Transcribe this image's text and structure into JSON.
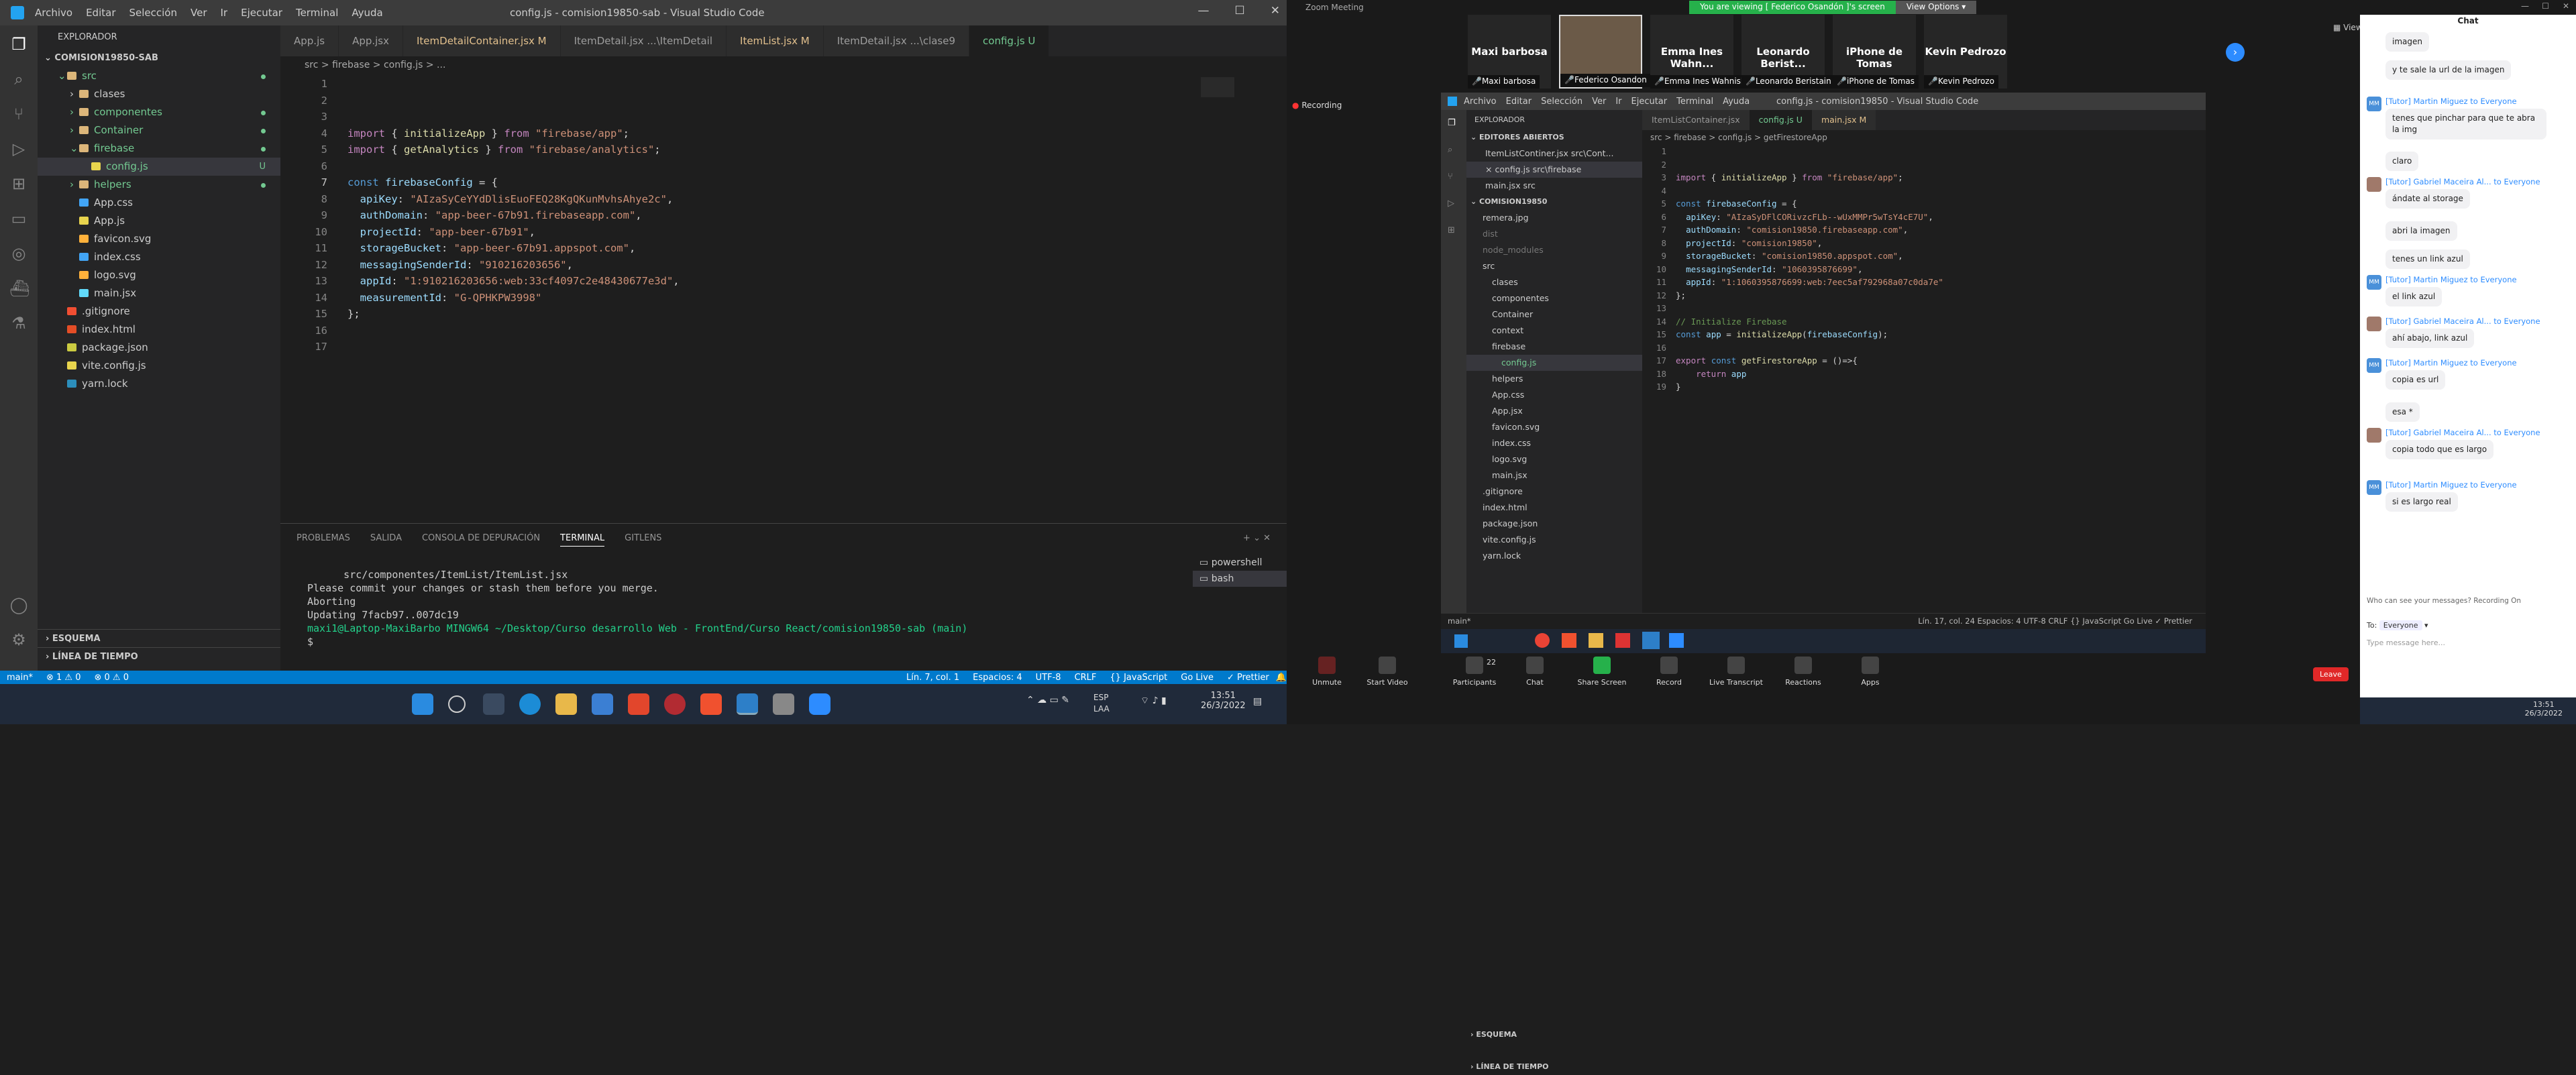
{
  "left_vscode": {
    "title": "config.js - comision19850-sab - Visual Studio Code",
    "menu": [
      "Archivo",
      "Editar",
      "Selección",
      "Ver",
      "Ir",
      "Ejecutar",
      "Terminal",
      "Ayuda"
    ],
    "explorer_title": "EXPLORADOR",
    "project": "COMISION19850-SAB",
    "tree": [
      {
        "label": "src",
        "depth": 1,
        "type": "folder-open",
        "dot": true
      },
      {
        "label": "clases",
        "depth": 2,
        "type": "folder"
      },
      {
        "label": "componentes",
        "depth": 2,
        "type": "folder",
        "dot": true
      },
      {
        "label": "Container",
        "depth": 2,
        "type": "folder",
        "dot": true
      },
      {
        "label": "firebase",
        "depth": 2,
        "type": "folder-open",
        "dot": true
      },
      {
        "label": "config.js",
        "depth": 3,
        "type": "js",
        "badge": "U",
        "selected": true
      },
      {
        "label": "helpers",
        "depth": 2,
        "type": "folder",
        "dot": true
      },
      {
        "label": "App.css",
        "depth": 2,
        "type": "css"
      },
      {
        "label": "App.js",
        "depth": 2,
        "type": "js"
      },
      {
        "label": "favicon.svg",
        "depth": 2,
        "type": "svg"
      },
      {
        "label": "index.css",
        "depth": 2,
        "type": "css"
      },
      {
        "label": "logo.svg",
        "depth": 2,
        "type": "svg"
      },
      {
        "label": "main.jsx",
        "depth": 2,
        "type": "jsx"
      },
      {
        "label": ".gitignore",
        "depth": 1,
        "type": "git"
      },
      {
        "label": "index.html",
        "depth": 1,
        "type": "html"
      },
      {
        "label": "package.json",
        "depth": 1,
        "type": "json"
      },
      {
        "label": "vite.config.js",
        "depth": 1,
        "type": "js"
      },
      {
        "label": "yarn.lock",
        "depth": 1,
        "type": "yarn"
      }
    ],
    "outline": "ESQUEMA",
    "timeline": "LÍNEA DE TIEMPO",
    "tabs": [
      {
        "label": "App.js",
        "active": false
      },
      {
        "label": "App.jsx",
        "active": false
      },
      {
        "label": "ItemDetailContainer.jsx M",
        "active": false
      },
      {
        "label": "ItemDetail.jsx ...\\ItemDetail",
        "active": false
      },
      {
        "label": "ItemList.jsx M",
        "active": false
      },
      {
        "label": "ItemDetail.jsx ...\\clase9",
        "active": false
      },
      {
        "label": "config.js U",
        "active": true
      }
    ],
    "breadcrumb": "src > firebase > config.js > ...",
    "code_lines": [
      {
        "n": "1",
        "t": ""
      },
      {
        "n": "2",
        "t": ""
      },
      {
        "n": "3",
        "t": ""
      },
      {
        "n": "4",
        "t": "import { initializeApp } from \"firebase/app\";"
      },
      {
        "n": "5",
        "t": "import { getAnalytics } from \"firebase/analytics\";"
      },
      {
        "n": "6",
        "t": ""
      },
      {
        "n": "7",
        "t": "const firebaseConfig = {"
      },
      {
        "n": "8",
        "t": "  apiKey: \"AIzaSyCeYYdDlisEuoFEQ28KgQKunMvhsAhye2c\","
      },
      {
        "n": "9",
        "t": "  authDomain: \"app-beer-67b91.firebaseapp.com\","
      },
      {
        "n": "10",
        "t": "  projectId: \"app-beer-67b91\","
      },
      {
        "n": "11",
        "t": "  storageBucket: \"app-beer-67b91.appspot.com\","
      },
      {
        "n": "12",
        "t": "  messagingSenderId: \"910216203656\","
      },
      {
        "n": "13",
        "t": "  appId: \"1:910216203656:web:33cf4097c2e48430677e3d\","
      },
      {
        "n": "14",
        "t": "  measurementId: \"G-QPHKPW3998\""
      },
      {
        "n": "15",
        "t": "};"
      },
      {
        "n": "16",
        "t": ""
      },
      {
        "n": "17",
        "t": ""
      }
    ],
    "panel_tabs": [
      "PROBLEMAS",
      "SALIDA",
      "CONSOLA DE DEPURACIÓN",
      "TERMINAL",
      "GITLENS"
    ],
    "terminal": [
      "      src/componentes/ItemList/ItemList.jsx",
      "Please commit your changes or stash them before you merge.",
      "Aborting",
      "Updating 7facb97..007dc19",
      "",
      "maxi1@Laptop-MaxiBarbo MINGW64 ~/Desktop/Curso desarrollo Web - FrontEnd/Curso React/comision19850-sab (main)",
      "$ "
    ],
    "terminal_list": [
      "powershell",
      "bash"
    ],
    "status_left": [
      "main*",
      "⊗ 1  ⚠ 0",
      "⊗ 0 ⚠ 0"
    ],
    "status_right": [
      "Lín. 7, col. 1",
      "Espacios: 4",
      "UTF-8",
      "CRLF",
      "{} JavaScript",
      "Go Live",
      "✓ Prettier"
    ]
  },
  "left_taskbar": {
    "lang": "ESP\nLAA",
    "time": "13:51",
    "date": "26/3/2022"
  },
  "zoom": {
    "window_title": "Zoom Meeting",
    "share_text": "You are viewing [ Federico Osandón ]'s screen",
    "view_options": "View Options ▾",
    "recording": "Recording",
    "participants": [
      {
        "name": "Maxi barbosa",
        "cap": "Maxi barbosa"
      },
      {
        "name": "",
        "cap": "Federico Osandon | Federic"
      },
      {
        "name": "Emma Ines Wahn...",
        "cap": "Emma Ines Wahnish"
      },
      {
        "name": "Leonardo Berist...",
        "cap": "Leonardo Beristain"
      },
      {
        "name": "iPhone de Tomas",
        "cap": "iPhone de Tomas"
      },
      {
        "name": "Kevin Pedrozo",
        "cap": "Kevin Pedrozo"
      }
    ],
    "view_label": "View",
    "controls": [
      "Unmute",
      "Start Video",
      "Participants",
      "Chat",
      "Share Screen",
      "Record",
      "Live Transcript",
      "Reactions",
      "Apps"
    ],
    "participants_count": "22",
    "leave": "Leave"
  },
  "remote_vscode": {
    "title": "config.js - comision19850 - Visual Studio Code",
    "menu": [
      "Archivo",
      "Editar",
      "Selección",
      "Ver",
      "Ir",
      "Ejecutar",
      "Terminal",
      "Ayuda"
    ],
    "tabs": [
      "ItemListContainer.jsx",
      "config.js U",
      "main.jsx M"
    ],
    "breadcrumb": "src > firebase > config.js > getFirestoreApp",
    "explorer": "EXPLORADOR",
    "open_editors": "EDITORES ABIERTOS",
    "open_list": [
      "ItemListContiner.jsx src\\Cont...",
      "× config.js src\\firebase",
      "main.jsx src"
    ],
    "project": "COMISION19850",
    "tree": [
      "remera.jpg",
      "dist",
      "node_modules",
      "src",
      "clases",
      "componentes",
      "Container",
      "context",
      "firebase",
      "config.js",
      "helpers",
      "App.css",
      "App.jsx",
      "favicon.svg",
      "index.css",
      "logo.svg",
      "main.jsx",
      ".gitignore",
      "index.html",
      "package.json",
      "vite.config.js",
      "yarn.lock"
    ],
    "outline": "ESQUEMA",
    "timeline": "LÍNEA DE TIEMPO",
    "code": [
      "",
      "",
      "import { initializeApp } from \"firebase/app\";",
      "",
      "const firebaseConfig = {",
      "  apiKey: \"AIzaSyDFlCORivzcFLb--wUxMMPr5wTsY4cE7U\",",
      "  authDomain: \"comision19850.firebaseapp.com\",",
      "  projectId: \"comision19850\",",
      "  storageBucket: \"comision19850.appspot.com\",",
      "  messagingSenderId: \"1060395876699\",",
      "  appId: \"1:1060395876699:web:7eec5af792968a07c0da7e\"",
      "};",
      "",
      "// Initialize Firebase",
      "const app = initializeApp(firebaseConfig);",
      "",
      "export const getFirestoreApp = ()=>{",
      "    return app",
      "}"
    ],
    "status": "Lín. 17, col. 24   Espacios: 4   UTF-8   CRLF   {} JavaScript   Go Live   ✓ Prettier",
    "git": "main*"
  },
  "chat": {
    "title": "Chat",
    "messages": [
      {
        "who": "",
        "text": "imagen",
        "initial": ""
      },
      {
        "who": "",
        "text": "y te sale la url de la imagen",
        "initial": ""
      },
      {
        "who": "[Tutor] Martin Miguez to Everyone",
        "text": "tenes que pinchar para que te abra la img",
        "initial": "MM"
      },
      {
        "who": "",
        "text": "claro",
        "initial": ""
      },
      {
        "who": "[Tutor] Gabriel Maceira Al... to Everyone",
        "text": "ándate al storage",
        "initial": ""
      },
      {
        "who": "",
        "text": "abri la imagen",
        "initial": ""
      },
      {
        "who": "",
        "text": "tenes un link azul",
        "initial": ""
      },
      {
        "who": "[Tutor] Martin Miguez to Everyone",
        "text": "el link azul",
        "initial": "MM"
      },
      {
        "who": "[Tutor] Gabriel Maceira Al... to Everyone",
        "text": "ahí abajo, link azul",
        "initial": ""
      },
      {
        "who": "[Tutor] Martin Miguez to Everyone",
        "text": "copia es url",
        "initial": "MM"
      },
      {
        "who": "",
        "text": "esa *",
        "initial": ""
      },
      {
        "who": "[Tutor] Gabriel Maceira Al... to Everyone",
        "text": "copia todo que es largo",
        "initial": ""
      },
      {
        "who": "[Tutor] Martin Miguez to Everyone",
        "text": "si es largo real",
        "initial": "MM"
      }
    ],
    "notice": "Who can see your messages? Recording On",
    "to_label": "To:",
    "to_value": "Everyone",
    "placeholder": "Type message here..."
  },
  "right_taskbar": {
    "time": "13:51",
    "date": "26/3/2022"
  }
}
